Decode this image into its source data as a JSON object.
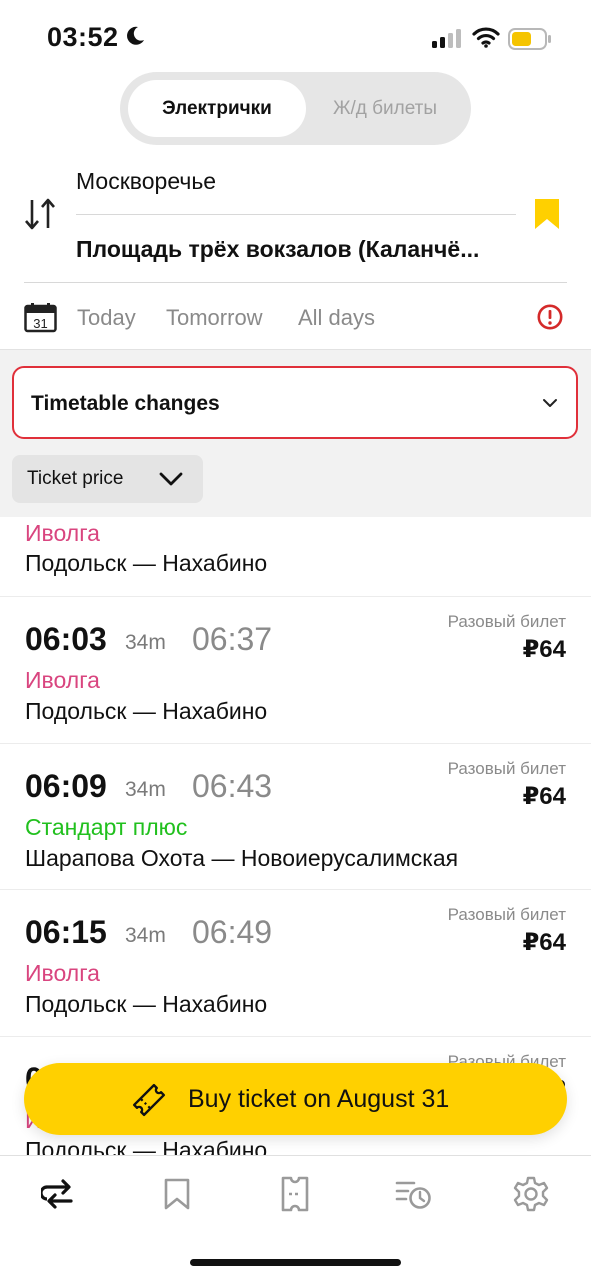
{
  "status_bar": {
    "time": "03:52"
  },
  "segment": {
    "active": "Электрички",
    "inactive": "Ж/д билеты"
  },
  "route": {
    "from": "Москворечье",
    "to": "Площадь трёх вокзалов (Каланчё..."
  },
  "dates": {
    "calendar_day": "31",
    "today": "Today",
    "tomorrow": "Tomorrow",
    "all": "All days"
  },
  "timetable_changes": "Timetable changes",
  "price_filter": "Ticket price",
  "trains": [
    {
      "type": "Иволга",
      "type_color": "pink",
      "route": "Подольск — Нахабино"
    },
    {
      "dep": "06:03",
      "duration": "34m",
      "arr": "06:37",
      "type": "Иволга",
      "type_color": "pink",
      "route": "Подольск — Нахабино",
      "price_label": "Разовый билет",
      "price": "₽64"
    },
    {
      "dep": "06:09",
      "duration": "34m",
      "arr": "06:43",
      "type": "Стандарт плюс",
      "type_color": "green",
      "route": "Шарапова Охота — Новоиерусалимская",
      "price_label": "Разовый билет",
      "price": "₽64"
    },
    {
      "dep": "06:15",
      "duration": "34m",
      "arr": "06:49",
      "type": "Иволга",
      "type_color": "pink",
      "route": "Подольск — Нахабино",
      "price_label": "Разовый билет",
      "price": "₽64"
    },
    {
      "dep": "0",
      "type": "И",
      "type_color": "pink",
      "route": "Подольск — Нахабино",
      "price_label": "Разовый билет",
      "price": "₽"
    }
  ],
  "buy_button": "Buy ticket on August 31",
  "colors": {
    "accent_yellow": "#ffd000",
    "alert_red": "#e0303a",
    "pink": "#d9457f",
    "green": "#21c01e"
  },
  "tabs": [
    "routes-icon",
    "bookmark-icon",
    "ticket-icon",
    "history-icon",
    "settings-icon"
  ]
}
